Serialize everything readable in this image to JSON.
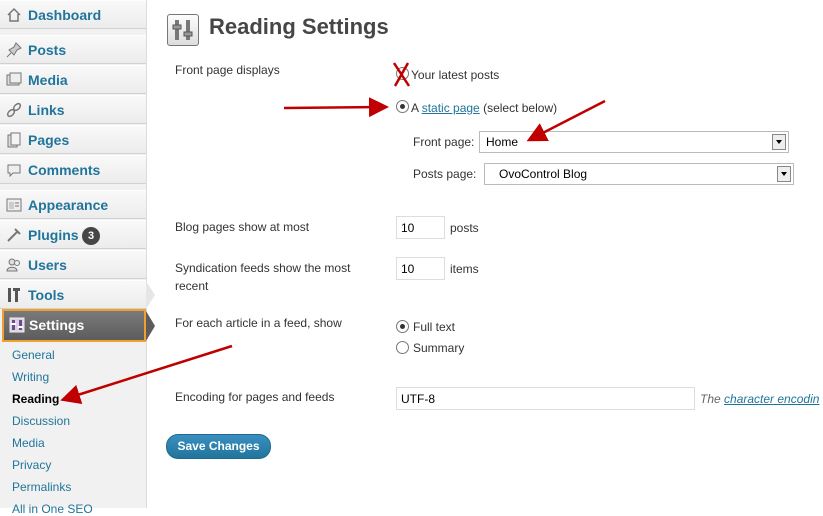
{
  "sidebar": {
    "items": [
      {
        "label": "Dashboard",
        "icon": "dashboard-icon"
      },
      {
        "label": "Posts",
        "icon": "pin-icon"
      },
      {
        "label": "Media",
        "icon": "media-icon"
      },
      {
        "label": "Links",
        "icon": "link-icon"
      },
      {
        "label": "Pages",
        "icon": "pages-icon"
      },
      {
        "label": "Comments",
        "icon": "comment-icon"
      },
      {
        "label": "Appearance",
        "icon": "appearance-icon"
      },
      {
        "label": "Plugins",
        "icon": "plugin-icon",
        "badge": "3"
      },
      {
        "label": "Users",
        "icon": "users-icon"
      },
      {
        "label": "Tools",
        "icon": "tools-icon"
      }
    ],
    "settings": {
      "label": "Settings",
      "icon": "settings-icon"
    },
    "submenu": [
      "General",
      "Writing",
      "Reading",
      "Discussion",
      "Media",
      "Privacy",
      "Permalinks",
      "All in One SEO"
    ]
  },
  "page": {
    "title": "Reading Settings"
  },
  "form": {
    "front_page_displays": {
      "label": "Front page displays",
      "option_latest": "Your latest posts",
      "option_static_prefix": "A",
      "option_static_link": "static page",
      "option_static_suffix": "(select below)",
      "front_page_label": "Front page:",
      "front_page_value": "Home",
      "posts_page_label": "Posts page:",
      "posts_page_value": "OvoControl Blog"
    },
    "blog_pages": {
      "label": "Blog pages show at most",
      "value": "10",
      "unit": "posts"
    },
    "syndication": {
      "label": "Syndication feeds show the most recent",
      "value": "10",
      "unit": "items"
    },
    "feed_article": {
      "label": "For each article in a feed, show",
      "option_full": "Full text",
      "option_summary": "Summary"
    },
    "encoding": {
      "label": "Encoding for pages and feeds",
      "value": "UTF-8",
      "hint_prefix": "The",
      "hint_link": "character encodin"
    },
    "save_label": "Save Changes"
  },
  "colors": {
    "link": "#21759b",
    "annotation": "#c00000",
    "highlight": "#f0a030"
  }
}
